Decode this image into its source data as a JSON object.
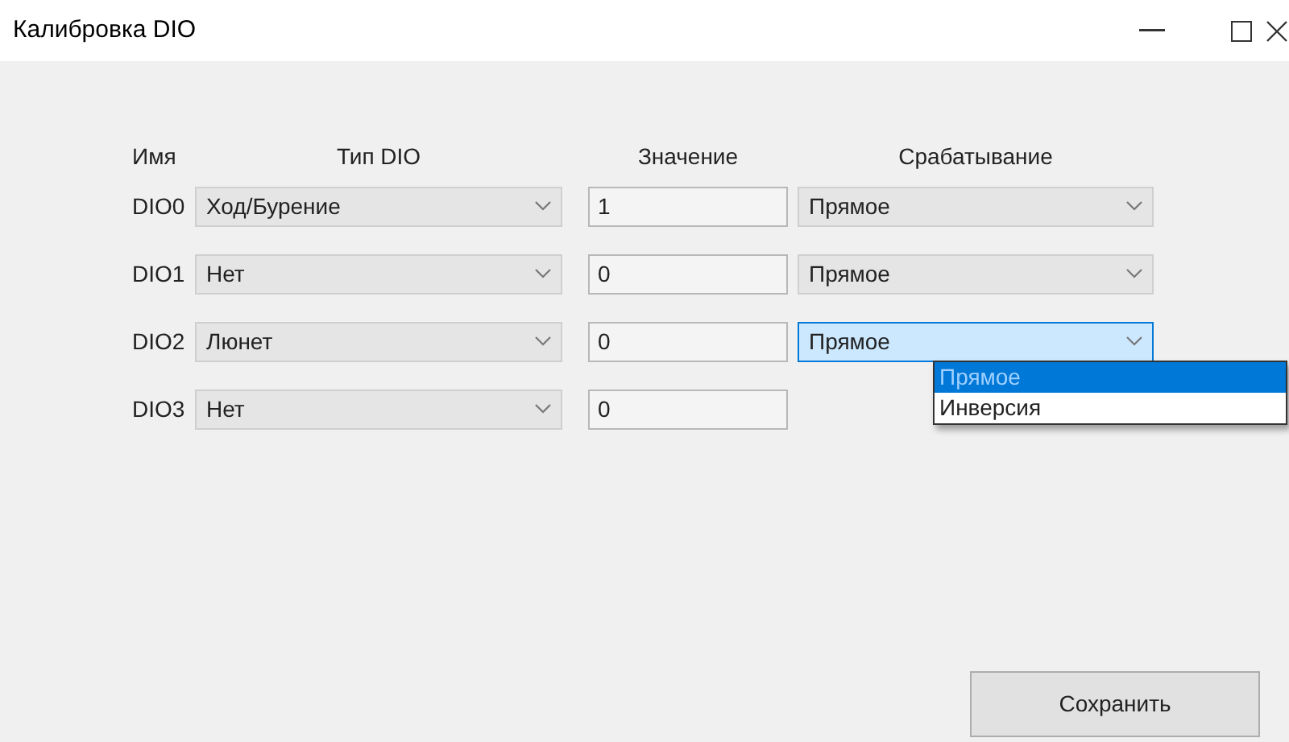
{
  "window": {
    "title": "Калибровка DIO"
  },
  "columns": [
    "Имя",
    "Тип DIO",
    "Значение",
    "Срабатывание"
  ],
  "rows": [
    {
      "name": "DIO0",
      "type": "Ход/Бурение",
      "value": "1",
      "trigger": {
        "text": "Прямое",
        "focused": false
      }
    },
    {
      "name": "DIO1",
      "type": "Нет",
      "value": "0",
      "trigger": {
        "text": "Прямое",
        "focused": false
      }
    },
    {
      "name": "DIO2",
      "type": "Люнет",
      "value": "0",
      "trigger": {
        "text": "Прямое",
        "focused": true,
        "options": [
          {
            "label": "Прямое",
            "selected": true
          },
          {
            "label": "Инверсия",
            "selected": false
          }
        ]
      }
    },
    {
      "name": "DIO3",
      "type": "Нет",
      "value": "0"
    }
  ],
  "save_button": "Сохранить"
}
